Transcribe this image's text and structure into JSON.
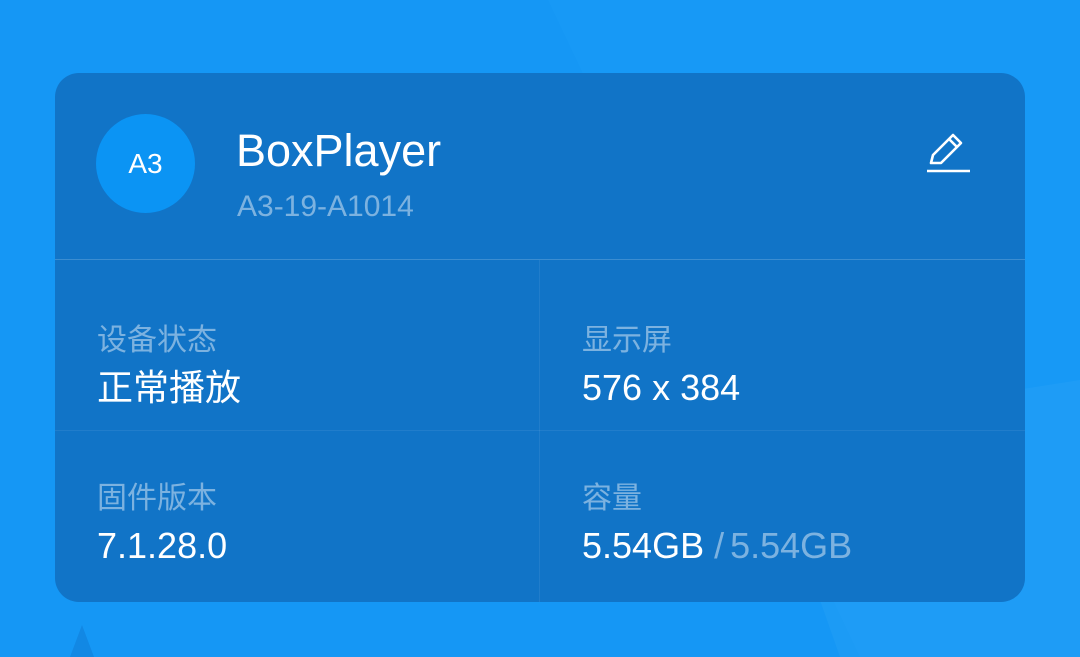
{
  "device": {
    "avatar_text": "A3",
    "name": "BoxPlayer",
    "id": "A3-19-A1014"
  },
  "edit": {
    "icon": "pencil-edit-icon"
  },
  "info": {
    "status": {
      "label": "设备状态",
      "value": "正常播放"
    },
    "display": {
      "label": "显示屏",
      "value": "576 x 384"
    },
    "firmware": {
      "label": "固件版本",
      "value": "7.1.28.0"
    },
    "capacity": {
      "label": "容量",
      "used": "5.54GB",
      "separator": "/",
      "total": "5.54GB"
    }
  },
  "colors": {
    "background": "#1597f5",
    "card": "#1174c7",
    "avatar": "#0b94f4",
    "text_primary": "#ffffff"
  }
}
